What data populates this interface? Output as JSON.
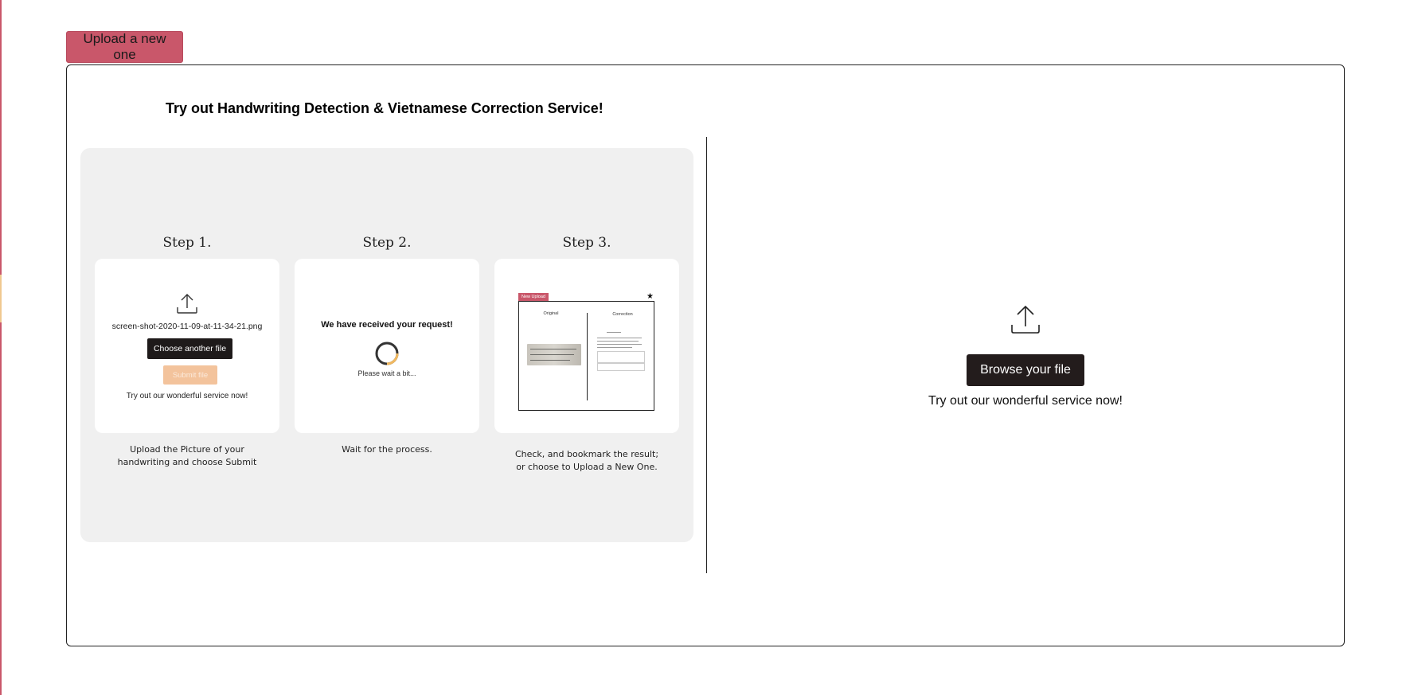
{
  "header": {
    "upload_new_label": "Upload a new one"
  },
  "main": {
    "title": "Try out Handwriting Detection & Vietnamese Correction Service!",
    "steps": [
      {
        "title": "Step 1.",
        "filename": "screen-shot-2020-11-09-at-11-34-21.png",
        "choose_label": "Choose another file",
        "submit_label": "Submit file",
        "tagline": "Try out our wonderful service now!",
        "caption_line1": "Upload the Picture of your",
        "caption_line2": "handwriting and choose Submit"
      },
      {
        "title": "Step 2.",
        "heading": "We have received your request!",
        "wait_text": "Please wait a bit...",
        "caption_line1": "Wait for the process.",
        "caption_line2": ""
      },
      {
        "title": "Step 3.",
        "tag_label": "New Upload",
        "original_label": "Original",
        "correction_label": "Correction",
        "caption_line1": "Check, and bookmark the result;",
        "caption_line2": "or choose to Upload a New One."
      }
    ],
    "upload": {
      "browse_label": "Browse your file",
      "tagline": "Try out our wonderful service now!"
    }
  },
  "icons": [
    "upload-icon",
    "loading-spinner-icon",
    "star-icon"
  ],
  "colors": {
    "accent": "#c9576a",
    "dark_button": "#231c1c",
    "disabled_submit": "#f3c39c",
    "panel_bg": "#f0f0f0"
  }
}
